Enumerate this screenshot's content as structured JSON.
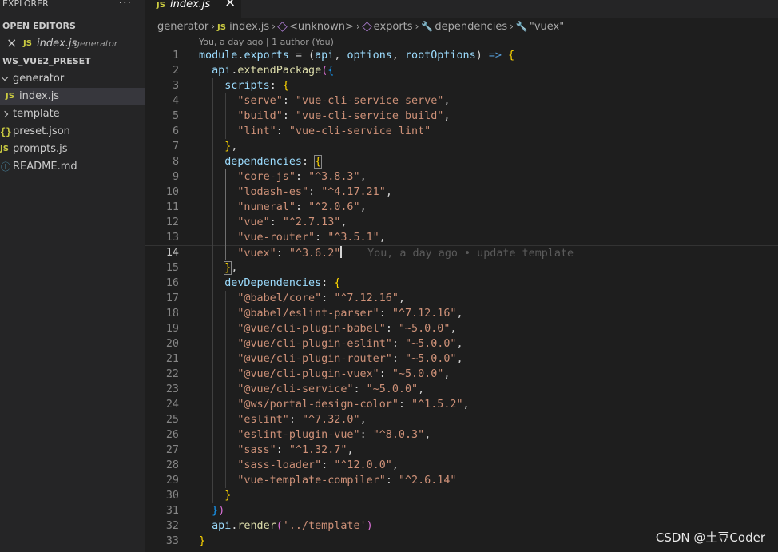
{
  "explorer": {
    "title": "EXPLORER",
    "open_editors_label": "OPEN EDITORS",
    "open_editor": {
      "icon": "JS",
      "name": "index.js",
      "desc": "generator"
    },
    "workspace": "WS_VUE2_PRESET",
    "tree": [
      {
        "name": "generator"
      },
      {
        "icon": "JS",
        "name": "index.js"
      },
      {
        "name": "template"
      },
      {
        "icon": "{}",
        "name": "preset.json"
      },
      {
        "icon": "JS",
        "name": "prompts.js"
      },
      {
        "icon": "ⓘ",
        "name": "README.md"
      }
    ]
  },
  "tab": {
    "icon": "JS",
    "name": "index.js"
  },
  "breadcrumb": [
    {
      "label": "generator"
    },
    {
      "icon": "JS",
      "label": "index.js"
    },
    {
      "label": "<unknown>"
    },
    {
      "label": "exports"
    },
    {
      "label": "dependencies"
    },
    {
      "label": "\"vuex\""
    }
  ],
  "blame_header": "You, a day ago | 1 author (You)",
  "inline_blame": "You, a day ago • update template",
  "code_lines": [
    "1",
    "2",
    "3",
    "4",
    "5",
    "6",
    "7",
    "8",
    "9",
    "10",
    "11",
    "12",
    "13",
    "14",
    "15",
    "16",
    "17",
    "18",
    "19",
    "20",
    "21",
    "22",
    "23",
    "24",
    "25",
    "26",
    "27",
    "28",
    "29",
    "30",
    "31",
    "32",
    "33"
  ],
  "code": {
    "l1": [
      "module",
      ".",
      "exports",
      " = (",
      "api",
      ", ",
      "options",
      ", ",
      "rootOptions",
      ") ",
      "=>",
      " {"
    ],
    "l2": [
      "api",
      ".",
      "extendPackage",
      "(",
      "{"
    ],
    "scripts_key": "scripts",
    "scripts": [
      {
        "k": "\"serve\"",
        "v": "\"vue-cli-service serve\""
      },
      {
        "k": "\"build\"",
        "v": "\"vue-cli-service build\""
      },
      {
        "k": "\"lint\"",
        "v": "\"vue-cli-service lint\""
      }
    ],
    "deps_key": "dependencies",
    "deps": [
      {
        "k": "\"core-js\"",
        "v": "\"^3.8.3\""
      },
      {
        "k": "\"lodash-es\"",
        "v": "\"^4.17.21\""
      },
      {
        "k": "\"numeral\"",
        "v": "\"^2.0.6\""
      },
      {
        "k": "\"vue\"",
        "v": "\"^2.7.13\""
      },
      {
        "k": "\"vue-router\"",
        "v": "\"^3.5.1\""
      },
      {
        "k": "\"vuex\"",
        "v": "\"^3.6.2\""
      }
    ],
    "devdeps_key": "devDependencies",
    "devdeps": [
      {
        "k": "\"@babel/core\"",
        "v": "\"^7.12.16\""
      },
      {
        "k": "\"@babel/eslint-parser\"",
        "v": "\"^7.12.16\""
      },
      {
        "k": "\"@vue/cli-plugin-babel\"",
        "v": "\"~5.0.0\""
      },
      {
        "k": "\"@vue/cli-plugin-eslint\"",
        "v": "\"~5.0.0\""
      },
      {
        "k": "\"@vue/cli-plugin-router\"",
        "v": "\"~5.0.0\""
      },
      {
        "k": "\"@vue/cli-plugin-vuex\"",
        "v": "\"~5.0.0\""
      },
      {
        "k": "\"@vue/cli-service\"",
        "v": "\"~5.0.0\""
      },
      {
        "k": "\"@ws/portal-design-color\"",
        "v": "\"^1.5.2\""
      },
      {
        "k": "\"eslint\"",
        "v": "\"^7.32.0\""
      },
      {
        "k": "\"eslint-plugin-vue\"",
        "v": "\"^8.0.3\""
      },
      {
        "k": "\"sass\"",
        "v": "\"^1.32.7\""
      },
      {
        "k": "\"sass-loader\"",
        "v": "\"^12.0.0\""
      },
      {
        "k": "\"vue-template-compiler\"",
        "v": "\"^2.6.14\""
      }
    ],
    "render": [
      "api",
      ".",
      "render",
      "(",
      "'../template'",
      ")"
    ]
  },
  "watermark": "CSDN @土豆Coder"
}
